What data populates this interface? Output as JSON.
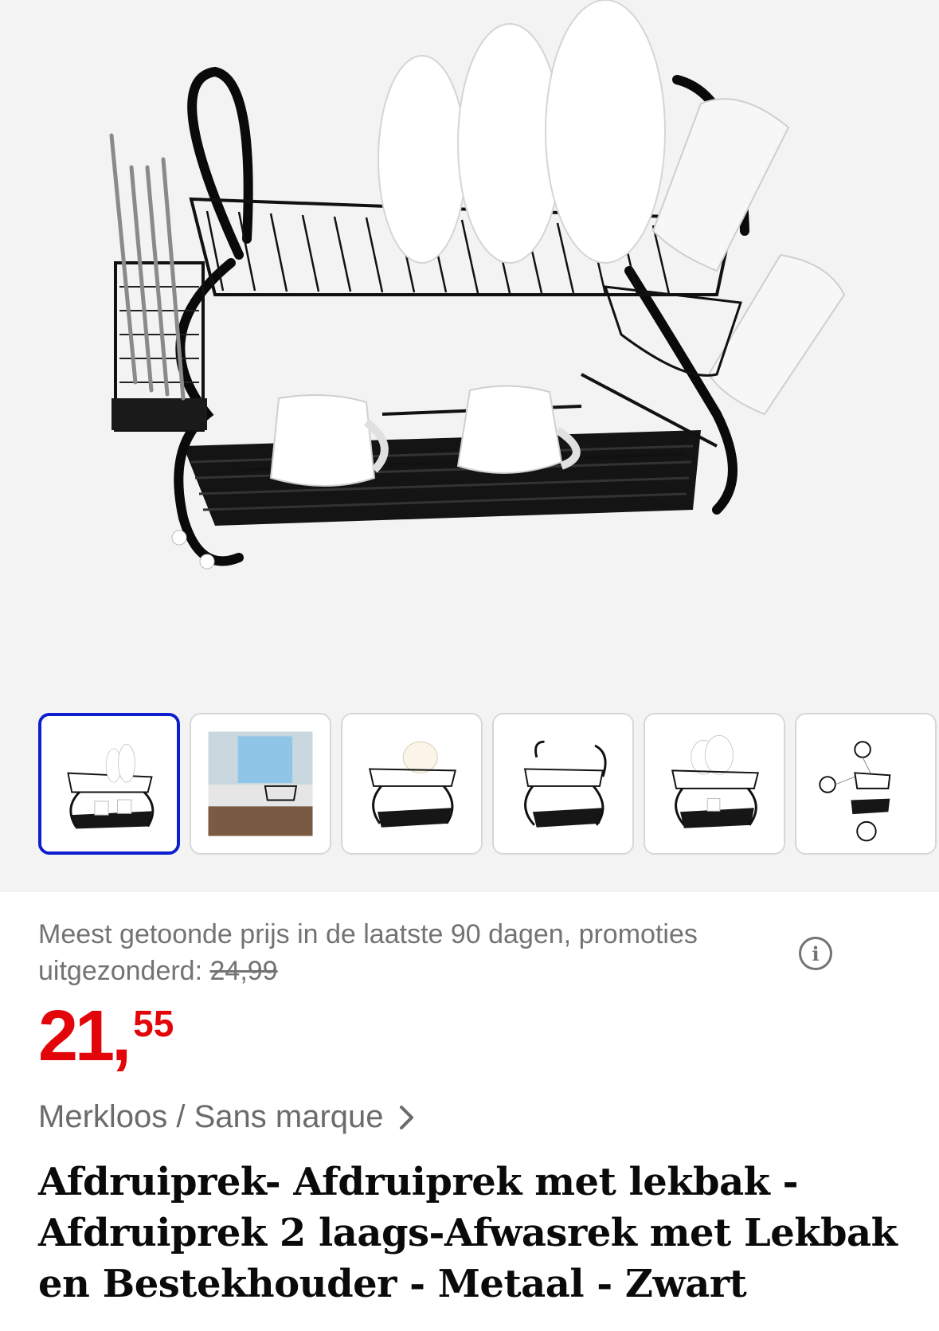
{
  "gallery": {
    "main_image_alt": "dish-rack-photo",
    "thumbnails": [
      {
        "name": "thumb-rack-black",
        "selected": true
      },
      {
        "name": "thumb-kitchen-scene",
        "selected": false
      },
      {
        "name": "thumb-rack-plates",
        "selected": false
      },
      {
        "name": "thumb-rack-empty",
        "selected": false
      },
      {
        "name": "thumb-rack-white-plates",
        "selected": false
      },
      {
        "name": "thumb-rack-parts",
        "selected": false
      }
    ],
    "selected_border_color": "#0b1fcf"
  },
  "pricing": {
    "lowest_price_text": "Meest getoonde prijs in de laatste 90 dagen, promoties uitgezonderd: ",
    "lowest_price_value": "24,99",
    "info_icon": "i",
    "price_euros": "21",
    "price_comma": ",",
    "price_cents": "55",
    "price_color": "#e2060a"
  },
  "product": {
    "brand": "Merkloos / Sans marque",
    "title": "Afdruiprek- Afdruiprek met lekbak - Afdruiprek 2 laags-Afwasrek met Lekbak en Bestekhouder - Metaal - Zwart"
  }
}
